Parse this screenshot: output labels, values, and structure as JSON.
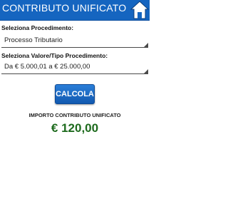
{
  "header": {
    "title": "CONTRIBUTO UNIFICATO",
    "home_icon": "home-icon",
    "background": "#1565c0"
  },
  "form": {
    "procedimento": {
      "label": "Seleziona Procedimento:",
      "value": "Processo Tributario"
    },
    "valore": {
      "label": "Seleziona Valore/Tipo Procedimento:",
      "value": "Da € 5.000,01 a € 25.000,00"
    }
  },
  "action": {
    "calc_label": "CALCOLA"
  },
  "result": {
    "label": "IMPORTO CONTRIBUTO UNIFICATO",
    "value": "€ 120,00",
    "color": "#1e6b1e"
  }
}
